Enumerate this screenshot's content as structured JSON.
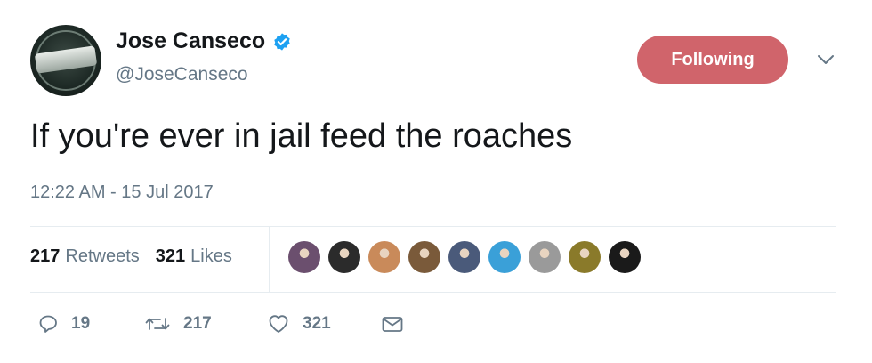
{
  "user": {
    "display_name": "Jose Canseco",
    "handle": "@JoseCanseco",
    "verified": true,
    "avatar_icon": "profile-photo-40-40-badge"
  },
  "follow_button": {
    "label": "Following",
    "color": "#d0646b"
  },
  "tweet": {
    "text": "If you're ever in jail feed the roaches",
    "timestamp": "12:22 AM - 15 Jul 2017"
  },
  "stats": {
    "retweets_count": "217",
    "retweets_label": "Retweets",
    "likes_count": "321",
    "likes_label": "Likes"
  },
  "liker_avatars": [
    {
      "name": "liker-avatar-1",
      "color": "#6b4f6e"
    },
    {
      "name": "liker-avatar-2",
      "color": "#2b2b2b"
    },
    {
      "name": "liker-avatar-3",
      "color": "#c98a5a"
    },
    {
      "name": "liker-avatar-4",
      "color": "#7a5a3a"
    },
    {
      "name": "liker-avatar-5",
      "color": "#4a5a7a"
    },
    {
      "name": "liker-avatar-6",
      "color": "#3aa0d8"
    },
    {
      "name": "liker-avatar-7",
      "color": "#9a9a9a"
    },
    {
      "name": "liker-avatar-8",
      "color": "#8a7a2a"
    },
    {
      "name": "liker-avatar-9",
      "color": "#1a1a1a"
    }
  ],
  "actions": {
    "reply_count": "19",
    "retweet_count": "217",
    "like_count": "321"
  },
  "colors": {
    "text_primary": "#14171a",
    "text_secondary": "#657786",
    "verified_blue": "#1da1f2",
    "divider": "#e6ecf0"
  }
}
